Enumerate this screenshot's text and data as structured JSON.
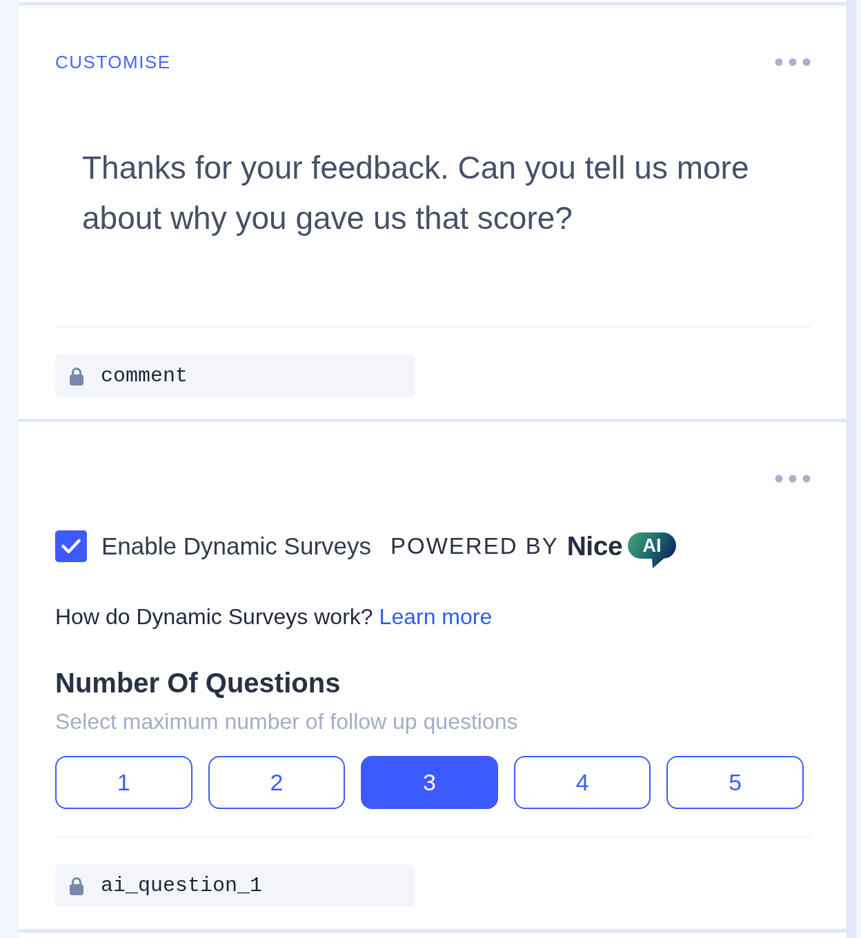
{
  "cards": [
    {
      "kind": "question",
      "label": "CUSTOMISE",
      "question": "Thanks for your feedback. Can you tell us more about why you gave us that score?",
      "variable": "comment"
    },
    {
      "kind": "dynamic_survey",
      "enable": {
        "label": "Enable Dynamic Surveys",
        "checked": true
      },
      "powered_by": {
        "text": "POWERED BY",
        "brand": "Nice",
        "badge": "AI"
      },
      "help": {
        "text": "How do Dynamic Surveys work?",
        "link": "Learn more"
      },
      "questions": {
        "title": "Number Of Questions",
        "subtitle": "Select maximum number of follow up questions",
        "options": [
          {
            "label": "1",
            "selected": false
          },
          {
            "label": "2",
            "selected": false
          },
          {
            "label": "3",
            "selected": true
          },
          {
            "label": "4",
            "selected": false
          },
          {
            "label": "5",
            "selected": false
          }
        ]
      },
      "variable": "ai_question_1"
    }
  ]
}
